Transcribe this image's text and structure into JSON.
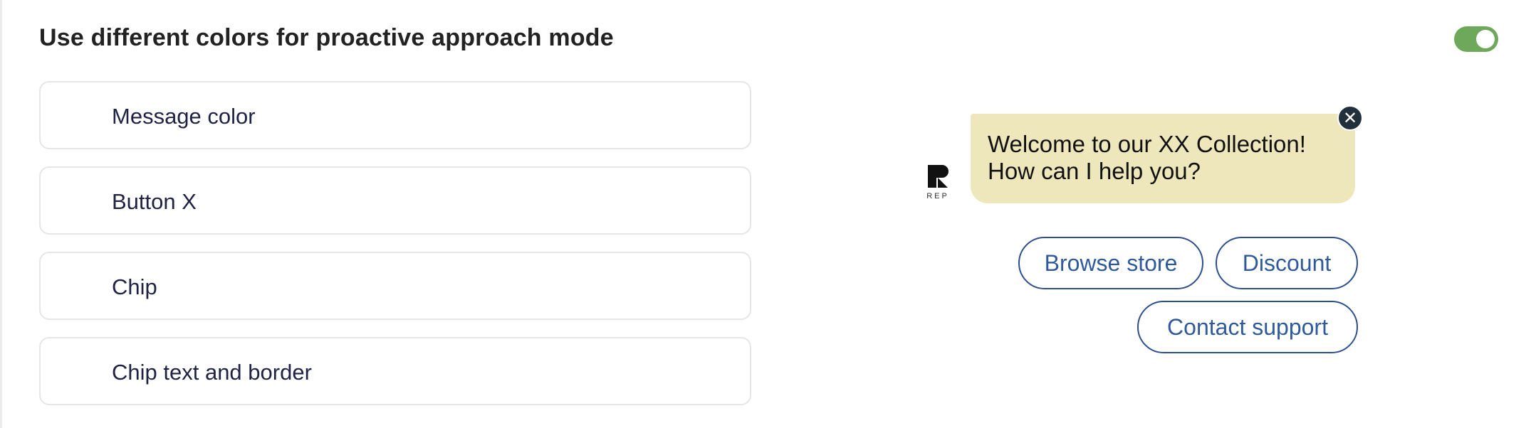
{
  "settings": {
    "title": "Use different colors for proactive approach mode",
    "toggle": {
      "state": "on",
      "color": "#6ea85a"
    },
    "color_options": [
      {
        "label": "Message color"
      },
      {
        "label": "Button X"
      },
      {
        "label": "Chip"
      },
      {
        "label": "Chip text and border"
      }
    ]
  },
  "preview": {
    "brand": {
      "logo_icon": "rep-logo-icon",
      "text": "REP"
    },
    "message": {
      "line1": "Welcome to our XX Collection!",
      "line2": "How can I help you?",
      "background": "#ede7bb"
    },
    "close_button": {
      "icon": "close-icon",
      "glyph": "✕",
      "color": "#22303b"
    },
    "chips": [
      {
        "label": "Browse store"
      },
      {
        "label": "Discount"
      },
      {
        "label": "Contact support"
      }
    ],
    "chip_color": "#2d4f8f"
  }
}
